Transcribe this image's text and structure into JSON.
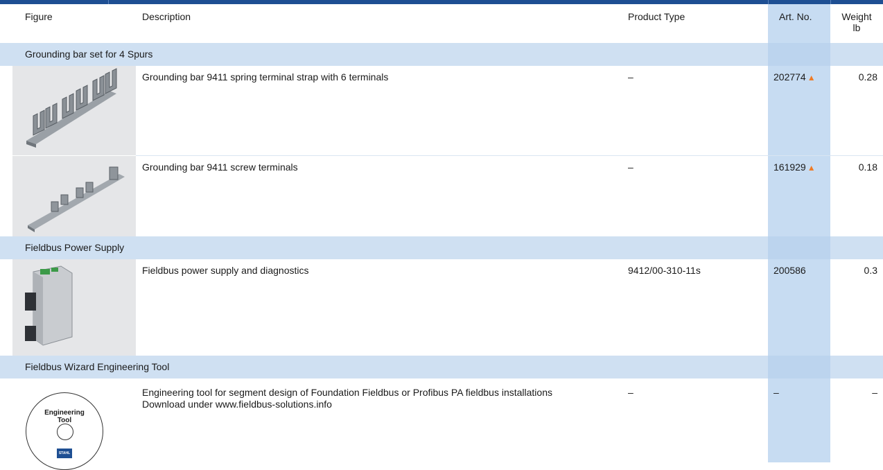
{
  "headers": {
    "figure": "Figure",
    "description": "Description",
    "product_type": "Product Type",
    "art_no": "Art. No.",
    "weight_line1": "Weight",
    "weight_line2": "lb"
  },
  "sections": [
    {
      "title": "Grounding bar set for 4 Spurs",
      "rows": [
        {
          "figure_icon": "grounding-bar-spring-image",
          "description": "Grounding bar 9411 spring terminal strap with 6 terminals",
          "product_type": "–",
          "art_no": "202774",
          "art_marker": "▲",
          "weight": "0.28"
        },
        {
          "figure_icon": "grounding-bar-screw-image",
          "description": "Grounding bar 9411 screw terminals",
          "product_type": "–",
          "art_no": "161929",
          "art_marker": "▲",
          "weight": "0.18"
        }
      ]
    },
    {
      "title": "Fieldbus Power Supply",
      "rows": [
        {
          "figure_icon": "power-supply-module-image",
          "description": "Fieldbus power supply and diagnostics",
          "product_type": "9412/00-310-11s",
          "art_no": "200586",
          "art_marker": "",
          "weight": "0.3"
        }
      ]
    },
    {
      "title": "Fieldbus Wizard Engineering Tool",
      "rows": [
        {
          "figure_icon": "engineering-tool-cd-image",
          "description": "Engineering tool for segment design of Foundation Fieldbus or Profibus PA fieldbus installations",
          "description_line2": "Download under www.fieldbus-solutions.info",
          "product_type": "–",
          "art_no": "–",
          "art_marker": "",
          "weight": "–",
          "cd_label_line1": "Engineering",
          "cd_label_line2": "Tool",
          "cd_logo_text": "STAHL"
        }
      ]
    }
  ],
  "colors": {
    "header_bar": "#1e4f93",
    "section_bg": "#cfe0f2",
    "art_col_bg": "#c7dcf2",
    "marker": "#ef7b25"
  }
}
